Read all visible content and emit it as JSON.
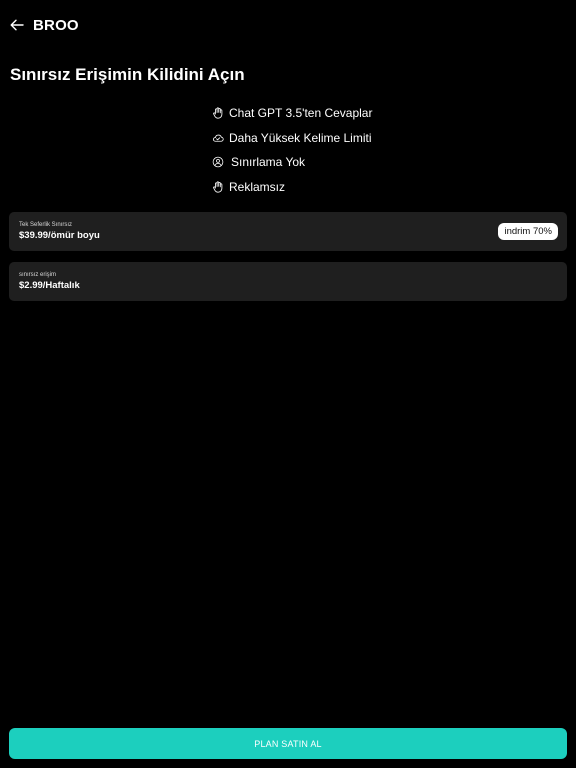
{
  "header": {
    "back_icon": "arrow-left-icon",
    "title": "BROO"
  },
  "headline": "Sınırsız Erişimin Kilidini Açın",
  "features": [
    {
      "icon": "hand-icon",
      "label": "Chat GPT 3.5'ten Cevaplar"
    },
    {
      "icon": "cloud-check-icon",
      "label": "Daha Yüksek Kelime Limiti"
    },
    {
      "icon": "user-circle-icon",
      "label": "Sınırlama Yok"
    },
    {
      "icon": "hand-icon",
      "label": "Reklamsız"
    }
  ],
  "plans": [
    {
      "small_label": "Tek Seferlik Sınırsız",
      "price": "$39.99/ömür boyu",
      "badge": "indrim 70%"
    },
    {
      "small_label": "sınırsız erişim",
      "price": "$2.99/Haftalık"
    }
  ],
  "cta": {
    "label": "PLAN SATIN AL"
  },
  "colors": {
    "background": "#000000",
    "card": "#1f1f1f",
    "accent": "#1ccfbe",
    "text": "#ffffff"
  }
}
